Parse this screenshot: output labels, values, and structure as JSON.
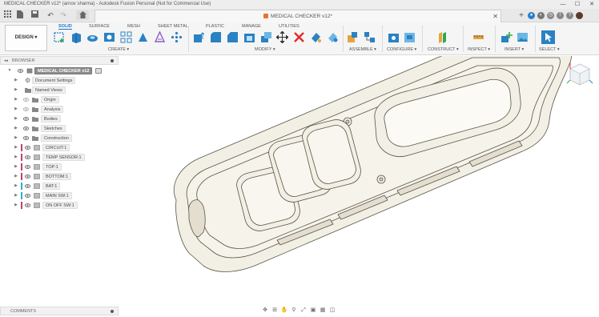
{
  "window": {
    "title": "MEDICAL CHECKER v12* (arnov sharma) - Autodesk Fusion Personal (Not for Commercial Use)",
    "minimize": "—",
    "maximize": "☐",
    "close": "✕"
  },
  "tabbar": {
    "document_title": "MEDICAL CHECKER v12*",
    "close_glyph": "✕",
    "add_glyph": "+"
  },
  "toolbar": {
    "workspace_label": "DESIGN ▾",
    "tabs": [
      "SOLID",
      "SURFACE",
      "MESH",
      "SHEET METAL",
      "PLASTIC",
      "MANAGE",
      "UTILITIES"
    ],
    "active_tab": "SOLID",
    "groups": [
      "CREATE ▾",
      "MODIFY ▾",
      "ASSEMBLE ▾",
      "CONFIGURE ▾",
      "CONSTRUCT ▾",
      "INSPECT ▾",
      "INSERT ▾",
      "SELECT ▾"
    ]
  },
  "browser": {
    "title": "BROWSER",
    "items": [
      {
        "label": "MEDICAL CHECKER v12"
      },
      {
        "label": "Document Settings"
      },
      {
        "label": "Named Views"
      },
      {
        "label": "Origin"
      },
      {
        "label": "Analysis"
      },
      {
        "label": "Bodies"
      },
      {
        "label": "Sketches"
      },
      {
        "label": "Construction"
      },
      {
        "label": "CIRCUIT:1"
      },
      {
        "label": "TEMP SENSOR:1"
      },
      {
        "label": "TOP:1"
      },
      {
        "label": "BOTTOM:1"
      },
      {
        "label": "BAT:1"
      },
      {
        "label": "MAIN SW:1"
      },
      {
        "label": "ON OFF SW:1"
      }
    ]
  },
  "comments": {
    "title": "COMMENTS"
  },
  "colors": {
    "accent": "#1a73c8",
    "model_fill": "#f2efe4",
    "model_edge": "#5a5448",
    "root_label": "#8c8c8c",
    "component_bars": [
      "#c0436b",
      "#c0436b",
      "#c0436b",
      "#c0436b",
      "#2bb0c5",
      "#2bb0c5",
      "#c0436b"
    ]
  },
  "icons": {
    "tab_bar": [
      "app-grid-icon",
      "file-icon",
      "save-icon",
      "undo-icon",
      "redo-icon",
      "home-icon"
    ],
    "nav": [
      "orbit-icon",
      "pan-icon",
      "hand-icon",
      "zoom-icon",
      "fit-icon",
      "display-icon",
      "grid-icon",
      "viewports-icon"
    ]
  }
}
